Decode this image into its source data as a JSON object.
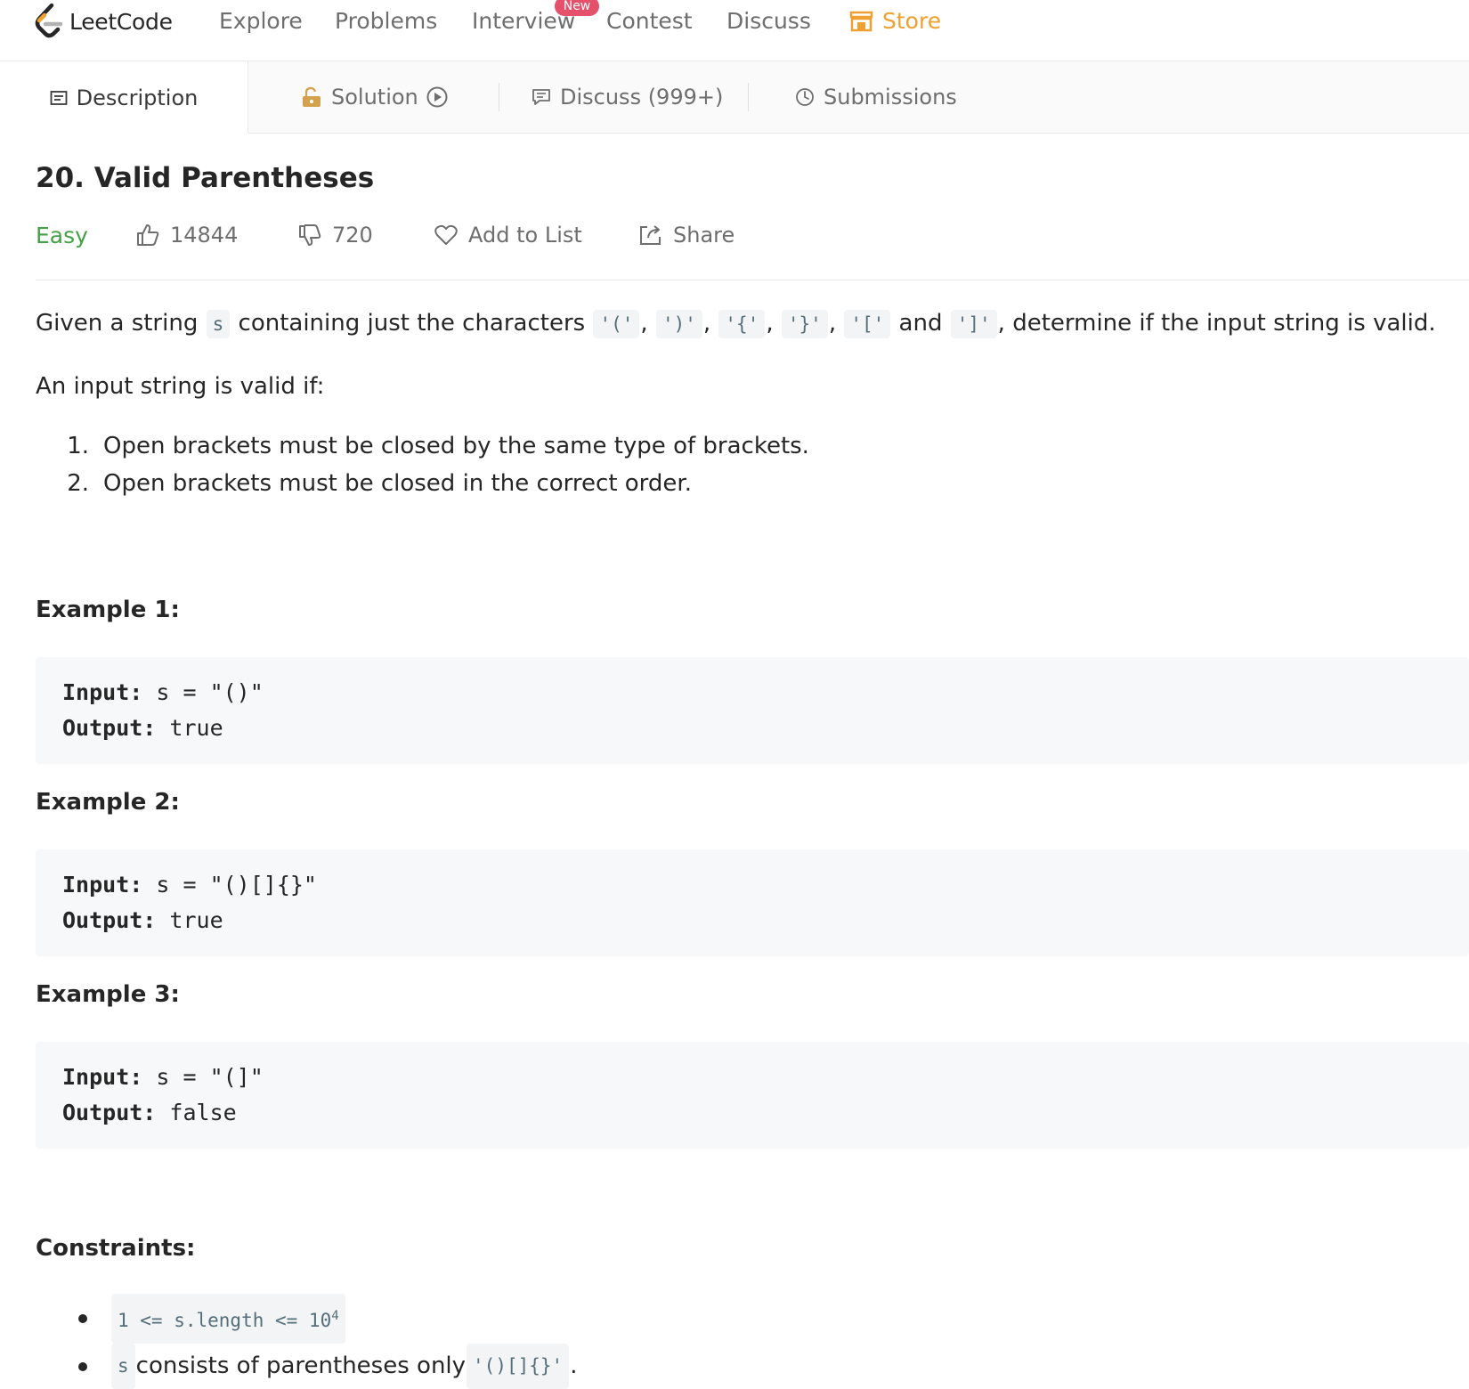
{
  "nav": {
    "logo_text": "LeetCode",
    "items": [
      "Explore",
      "Problems",
      "Interview",
      "Contest",
      "Discuss"
    ],
    "new_badge": "New",
    "store_label": "Store"
  },
  "tabs": {
    "description": "Description",
    "solution": "Solution",
    "discuss": "Discuss (999+)",
    "submissions": "Submissions"
  },
  "problem": {
    "title": "20. Valid Parentheses",
    "difficulty": "Easy",
    "likes": "14844",
    "dislikes": "720",
    "add_to_list": "Add to List",
    "share": "Share"
  },
  "description": {
    "p1_a": "Given a string ",
    "p1_s": "s",
    "p1_b": " containing just the characters ",
    "c1": "'('",
    "c2": "')'",
    "c3": "'{'",
    "c4": "'}'",
    "c5": "'['",
    "and": " and ",
    "c6": "']'",
    "p1_c": ", determine if the input string is valid.",
    "comma": ", ",
    "p2": "An input string is valid if:",
    "rules": [
      "Open brackets must be closed by the same type of brackets.",
      "Open brackets must be closed in the correct order."
    ],
    "rule_nums": [
      "1.",
      "2."
    ]
  },
  "examples": [
    {
      "heading": "Example 1:",
      "input_label": "Input:",
      "input": " s = \"()\"",
      "output_label": "Output:",
      "output": " true"
    },
    {
      "heading": "Example 2:",
      "input_label": "Input:",
      "input": " s = \"()[]{}\"",
      "output_label": "Output:",
      "output": " true"
    },
    {
      "heading": "Example 3:",
      "input_label": "Input:",
      "input": " s = \"(]\"",
      "output_label": "Output:",
      "output": " false"
    }
  ],
  "constraints": {
    "heading": "Constraints:",
    "c1_code": "1 <= s.length <= 10",
    "c1_sup": "4",
    "c2_s": "s",
    "c2_text": " consists of parentheses only ",
    "c2_code": "'()[]{}'",
    "c2_end": "."
  },
  "colors": {
    "easy": "#43a047",
    "store": "#f0a030",
    "badge": "#e5506b",
    "solution_lock": "#d4a24c"
  }
}
